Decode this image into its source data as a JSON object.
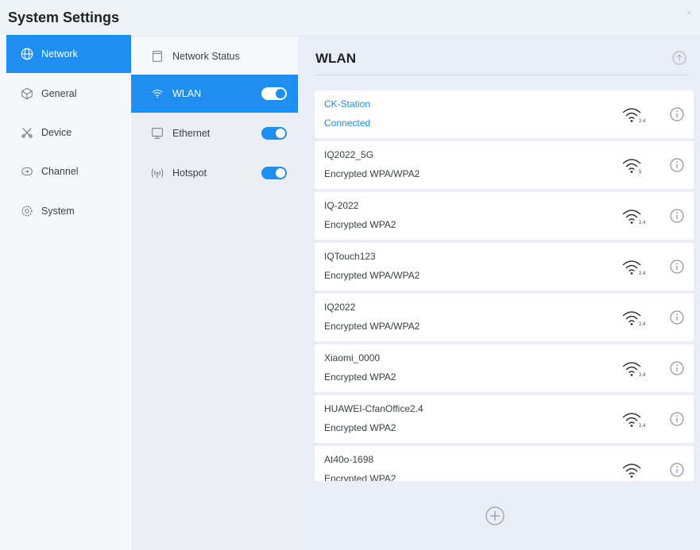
{
  "window": {
    "title": "System Settings",
    "close_glyph": "×"
  },
  "sidebar": {
    "items": [
      {
        "label": "Network",
        "icon": "globe-icon",
        "active": true
      },
      {
        "label": "General",
        "icon": "cube-icon",
        "active": false
      },
      {
        "label": "Device",
        "icon": "tools-icon",
        "active": false
      },
      {
        "label": "Channel",
        "icon": "input-icon",
        "active": false
      },
      {
        "label": "System",
        "icon": "gear-icon",
        "active": false
      }
    ]
  },
  "submenu": {
    "items": [
      {
        "label": "Network Status",
        "icon": "document-icon",
        "toggle": null
      },
      {
        "label": "WLAN",
        "icon": "wifi-icon",
        "toggle": true,
        "active": true
      },
      {
        "label": "Ethernet",
        "icon": "ethernet-icon",
        "toggle": true
      },
      {
        "label": "Hotspot",
        "icon": "hotspot-icon",
        "toggle": true
      }
    ]
  },
  "main": {
    "title": "WLAN",
    "networks": [
      {
        "ssid": "CK-Station",
        "status": "Connected",
        "band": "2.4",
        "connected": true
      },
      {
        "ssid": "IQ2022_5G",
        "status": "Encrypted WPA/WPA2",
        "band": "5"
      },
      {
        "ssid": "IQ-2022",
        "status": "Encrypted WPA2",
        "band": "2.4"
      },
      {
        "ssid": "IQTouch123",
        "status": "Encrypted WPA/WPA2",
        "band": "2.4"
      },
      {
        "ssid": "IQ2022",
        "status": "Encrypted WPA/WPA2",
        "band": "2.4"
      },
      {
        "ssid": "Xiaomi_0000",
        "status": "Encrypted WPA2",
        "band": "2.4"
      },
      {
        "ssid": "HUAWEI-CfanOffice2.4",
        "status": "Encrypted WPA2",
        "band": "2.4"
      },
      {
        "ssid": "At40o-1698",
        "status": "Encrypted WPA2",
        "band": ""
      }
    ]
  },
  "colors": {
    "accent": "#1f8ef1",
    "text": "#3b4048"
  }
}
